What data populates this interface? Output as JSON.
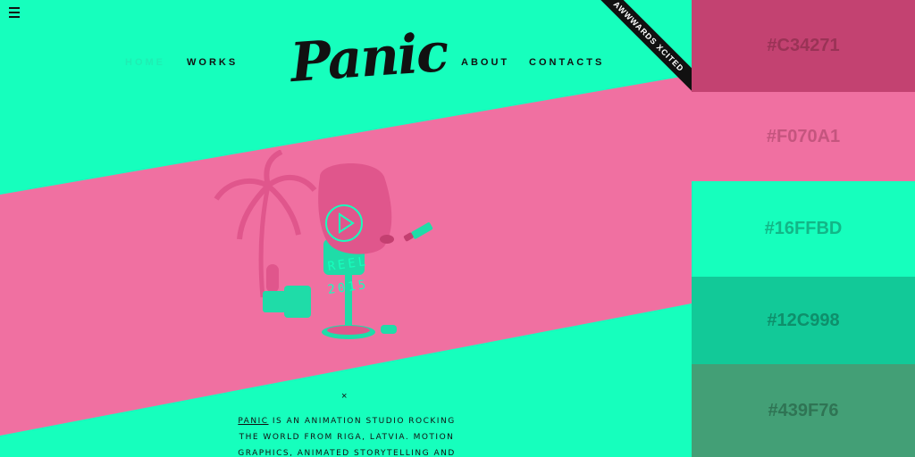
{
  "nav": {
    "home": "HOME",
    "works": "WORKS",
    "about": "ABOUT",
    "contacts": "CONTACTS"
  },
  "logo": "Panic",
  "ribbon": "AWWWARDS XCITED",
  "reel": {
    "line1": "REEL",
    "line2": "2015"
  },
  "close_symbol": "×",
  "about": {
    "brand": "PANIC",
    "line1_rest": " IS AN ANIMATION STUDIO ROCKING",
    "line2": "THE WORLD FROM RIGA, LATVIA. MOTION",
    "line3": "GRAPHICS, ANIMATED STORYTELLING AND"
  },
  "palette": [
    {
      "label": "#C34271",
      "bg": "#C34271",
      "fg": "#9a3356"
    },
    {
      "label": "#F070A1",
      "bg": "#F070A1",
      "fg": "#c4557e"
    },
    {
      "label": "#16FFBD",
      "bg": "#16FFBD",
      "fg": "#12b687"
    },
    {
      "label": "#12C998",
      "bg": "#12C998",
      "fg": "#0e8f6b"
    },
    {
      "label": "#439F76",
      "bg": "#439F76",
      "fg": "#2f7454"
    }
  ],
  "colors": {
    "mint": "#16FFBD",
    "pink": "#F070A1"
  }
}
